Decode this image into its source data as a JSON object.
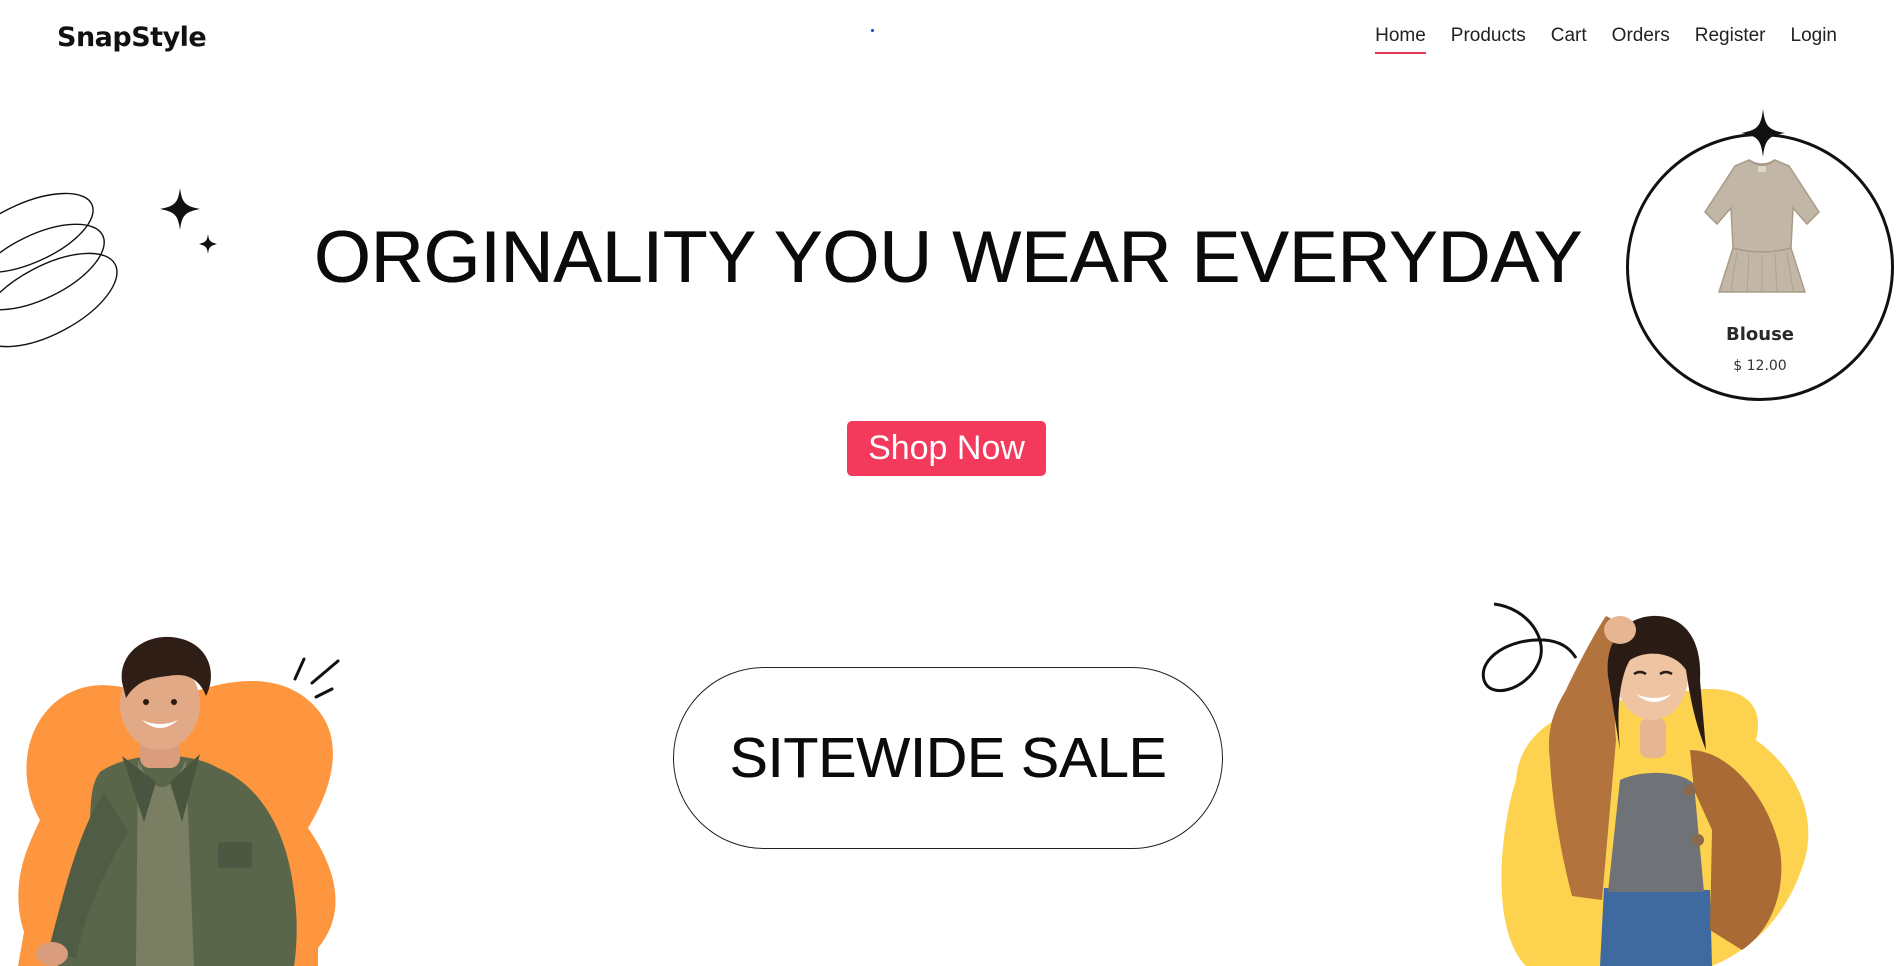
{
  "brand": {
    "logo_text": "SnapStyle"
  },
  "nav": {
    "items": [
      {
        "label": "Home",
        "active": true
      },
      {
        "label": "Products",
        "active": false
      },
      {
        "label": "Cart",
        "active": false
      },
      {
        "label": "Orders",
        "active": false
      },
      {
        "label": "Register",
        "active": false
      },
      {
        "label": "Login",
        "active": false
      }
    ]
  },
  "hero": {
    "headline": "ORGINALITY YOU WEAR EVERYDAY",
    "cta_label": "Shop Now",
    "sale_label": "SITEWIDE SALE"
  },
  "featured_product": {
    "name": "Blouse",
    "price": "$ 12.00"
  },
  "colors": {
    "accent": "#f33a5c",
    "blob_orange": "#fd963e",
    "blob_yellow": "#fdd24e",
    "nav_underline": "#e0385a"
  },
  "images": {
    "left_model": "smiling young man in olive jacket",
    "right_model": "laughing young woman in brown suede jacket",
    "product": "beige peplum blouse"
  }
}
